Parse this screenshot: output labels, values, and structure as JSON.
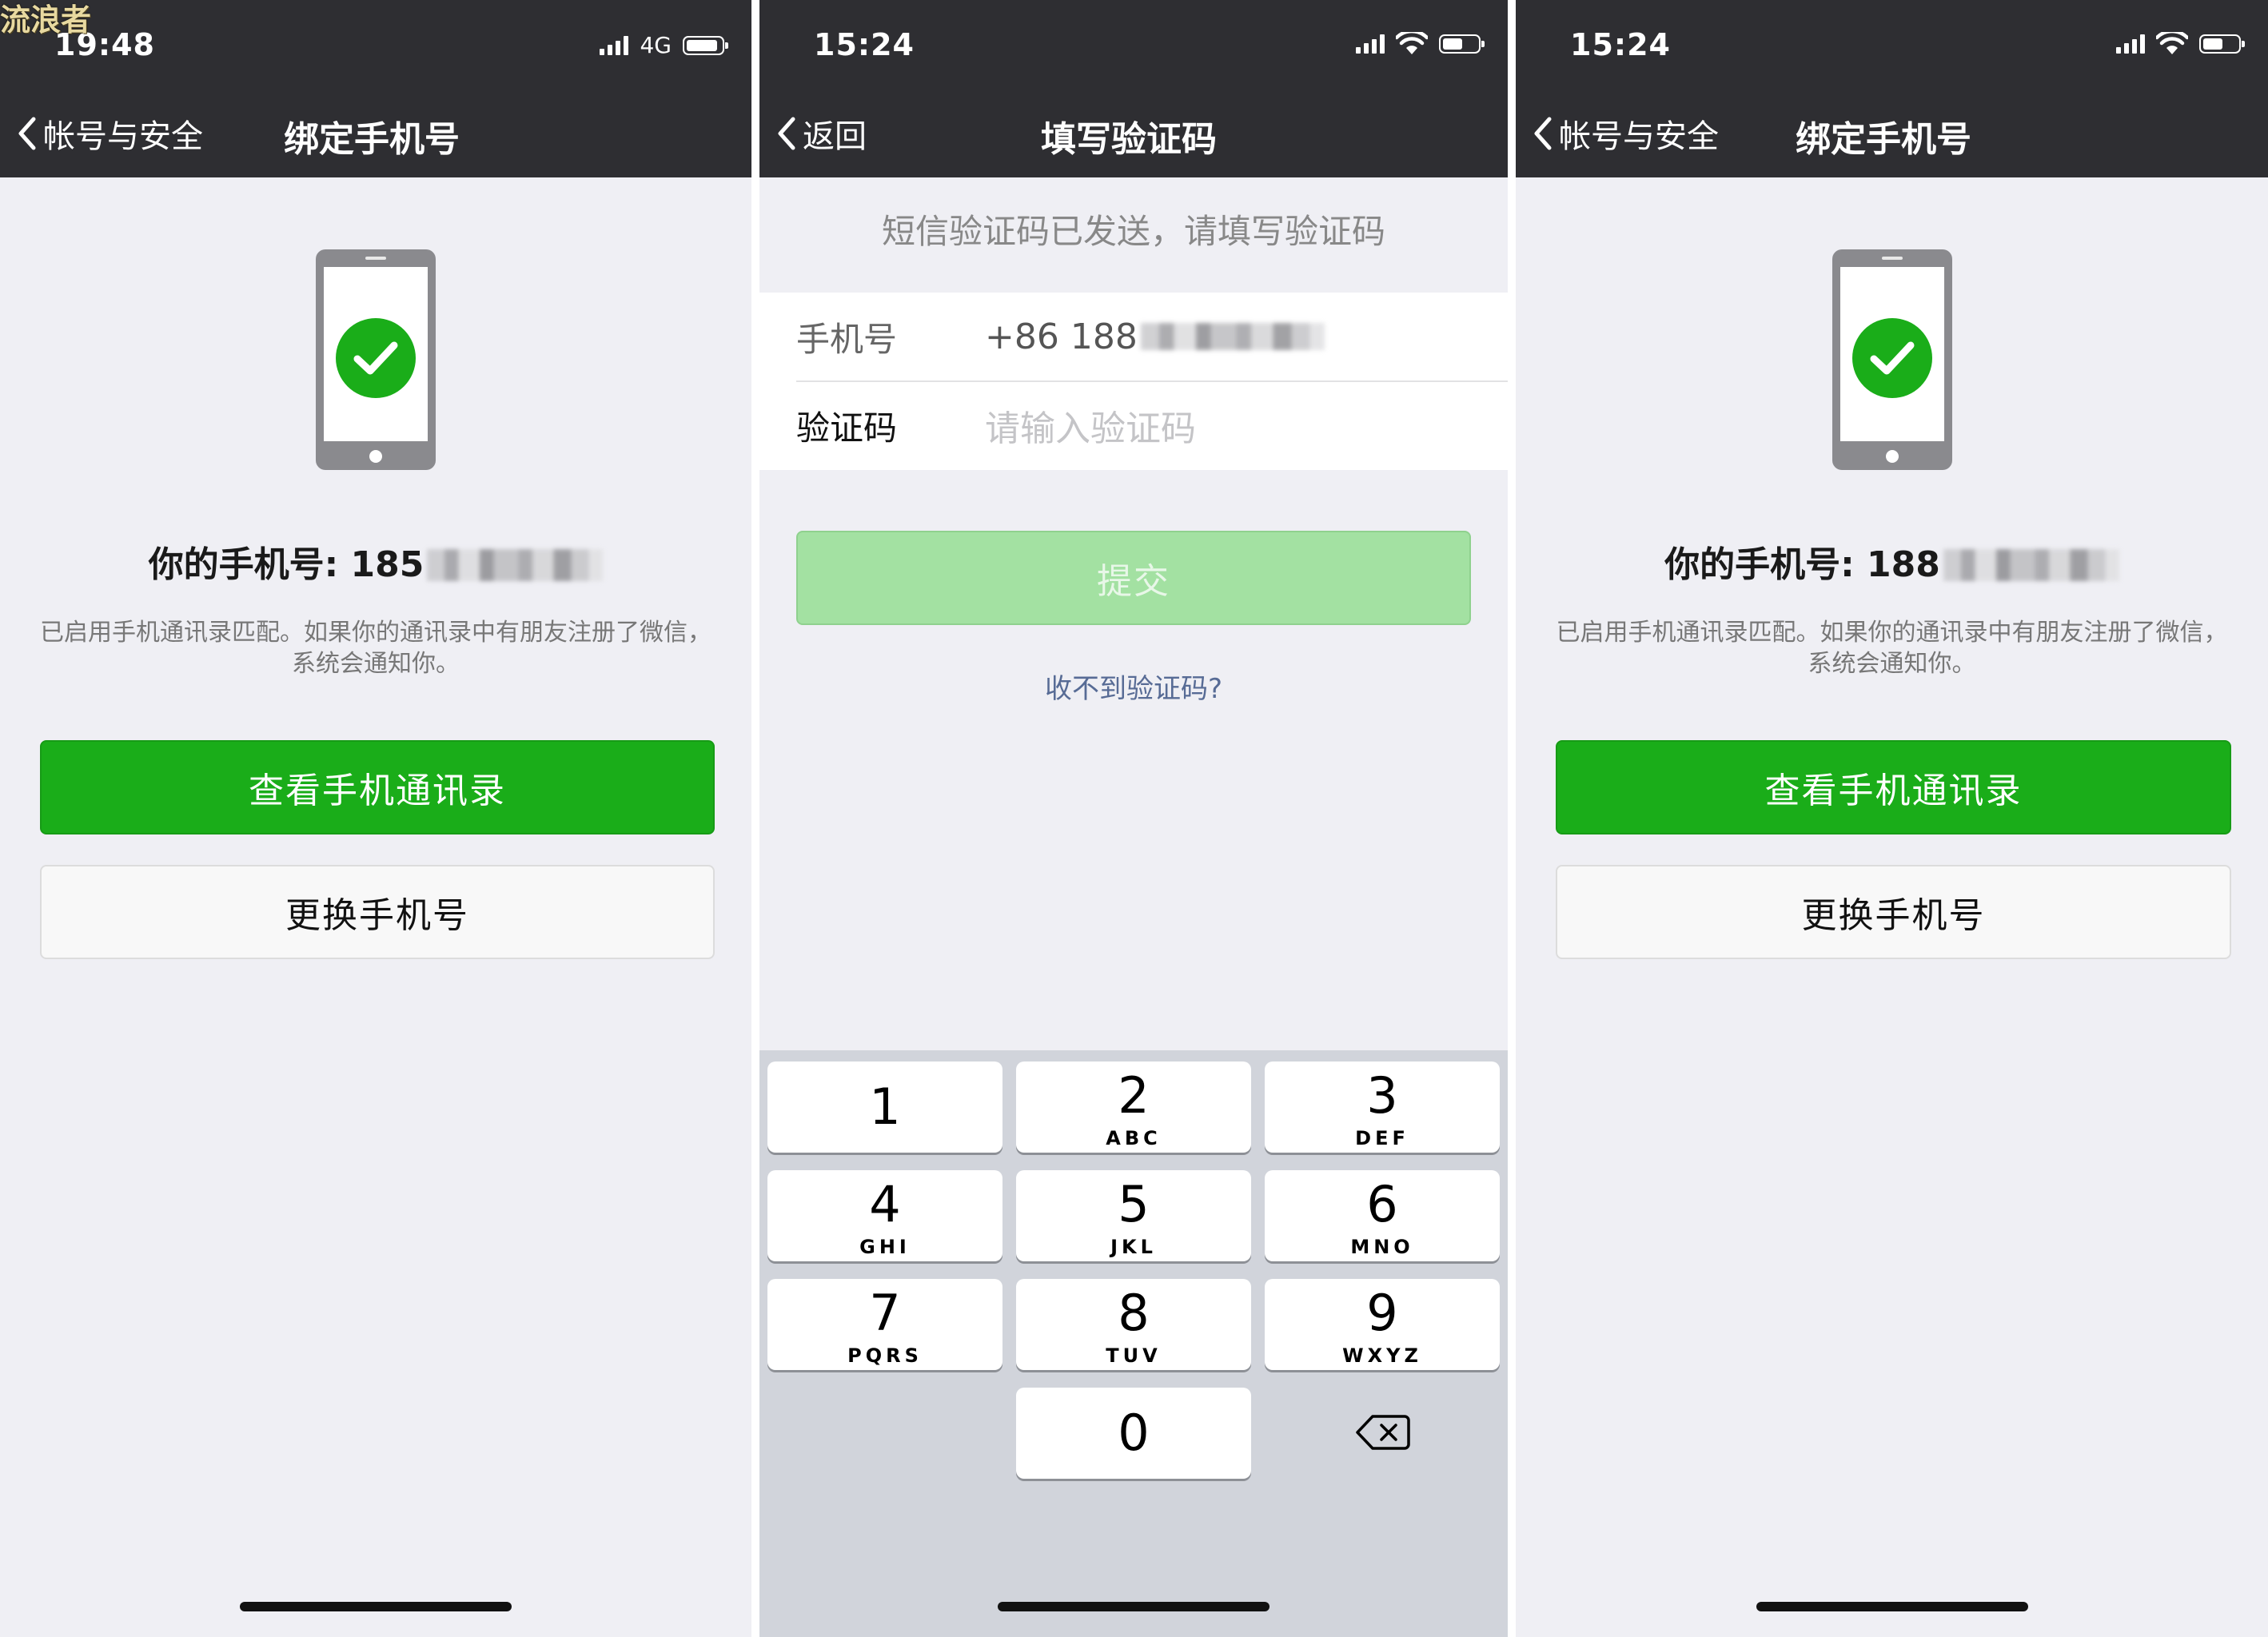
{
  "watermark": "流浪者",
  "screens": {
    "bind_left": {
      "status": {
        "time": "19:48",
        "network": "4G"
      },
      "nav": {
        "back": "帐号与安全",
        "title": "绑定手机号"
      },
      "phone_label": "你的手机号: ",
      "phone_number": "185",
      "description": "已启用手机通讯录匹配。如果你的通讯录中有朋友注册了微信，系统会通知你。",
      "primary_button": "查看手机通讯录",
      "secondary_button": "更换手机号"
    },
    "verify": {
      "status": {
        "time": "15:24"
      },
      "nav": {
        "back": "返回",
        "title": "填写验证码"
      },
      "tip": "短信验证码已发送，请填写验证码",
      "phone_label": "手机号",
      "phone_value": "+86 188",
      "code_label": "验证码",
      "code_placeholder": "请输入验证码",
      "submit_button": "提交",
      "no_code_link": "收不到验证码?",
      "keypad": [
        {
          "num": "1",
          "sub": ""
        },
        {
          "num": "2",
          "sub": "ABC"
        },
        {
          "num": "3",
          "sub": "DEF"
        },
        {
          "num": "4",
          "sub": "GHI"
        },
        {
          "num": "5",
          "sub": "JKL"
        },
        {
          "num": "6",
          "sub": "MNO"
        },
        {
          "num": "7",
          "sub": "PQRS"
        },
        {
          "num": "8",
          "sub": "TUV"
        },
        {
          "num": "9",
          "sub": "WXYZ"
        },
        {
          "num": "0",
          "sub": ""
        }
      ]
    },
    "bind_right": {
      "status": {
        "time": "15:24"
      },
      "nav": {
        "back": "帐号与安全",
        "title": "绑定手机号"
      },
      "phone_label": "你的手机号: ",
      "phone_number": "188",
      "description": "已启用手机通讯录匹配。如果你的通讯录中有朋友注册了微信，系统会通知你。",
      "primary_button": "查看手机通讯录",
      "secondary_button": "更换手机号"
    }
  },
  "icons": {
    "signal": "signal-bars-icon",
    "wifi": "wifi-icon",
    "battery": "battery-icon",
    "back": "chevron-left-icon",
    "phone_check": "phone-check-icon",
    "delete": "backspace-icon"
  },
  "colors": {
    "nav_bg": "#2e2e32",
    "page_bg": "#efeff4",
    "green": "#1aad19",
    "green_disabled": "#a3e1a2",
    "link": "#576b95",
    "keypad_bg": "#d1d4db"
  }
}
